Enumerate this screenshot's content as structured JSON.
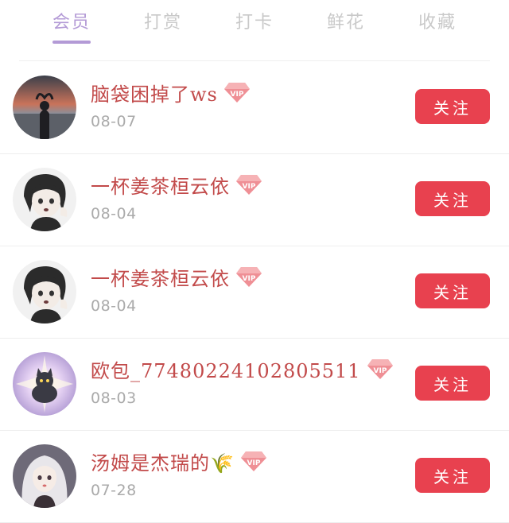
{
  "tabs": [
    {
      "label": "会员",
      "active": true
    },
    {
      "label": "打赏",
      "active": false
    },
    {
      "label": "打卡",
      "active": false
    },
    {
      "label": "鲜花",
      "active": false
    },
    {
      "label": "收藏",
      "active": false
    }
  ],
  "vip_badge_text": "VIP",
  "colors": {
    "tab_active": "#b39ad6",
    "tab_inactive": "#c9c9c9",
    "name": "#c24a4a",
    "date": "#aaaaaa",
    "follow_button": "#e8414f"
  },
  "users": [
    {
      "name": "脑袋困掉了ws",
      "date": "08-07",
      "follow_label": "关注",
      "avatar_icon": "heart-hands-photo-avatar"
    },
    {
      "name": "一杯姜茶桓云依",
      "date": "08-04",
      "follow_label": "关注",
      "avatar_icon": "anime-girl-avatar"
    },
    {
      "name": "一杯姜茶桓云依",
      "date": "08-04",
      "follow_label": "关注",
      "avatar_icon": "anime-girl-avatar"
    },
    {
      "name": "欧包_77480224102805511",
      "date": "08-03",
      "follow_label": "关注",
      "avatar_icon": "glowing-cat-avatar"
    },
    {
      "name": "汤姆是杰瑞的🌾",
      "date": "07-28",
      "follow_label": "关注",
      "avatar_icon": "white-hair-girl-avatar"
    }
  ]
}
